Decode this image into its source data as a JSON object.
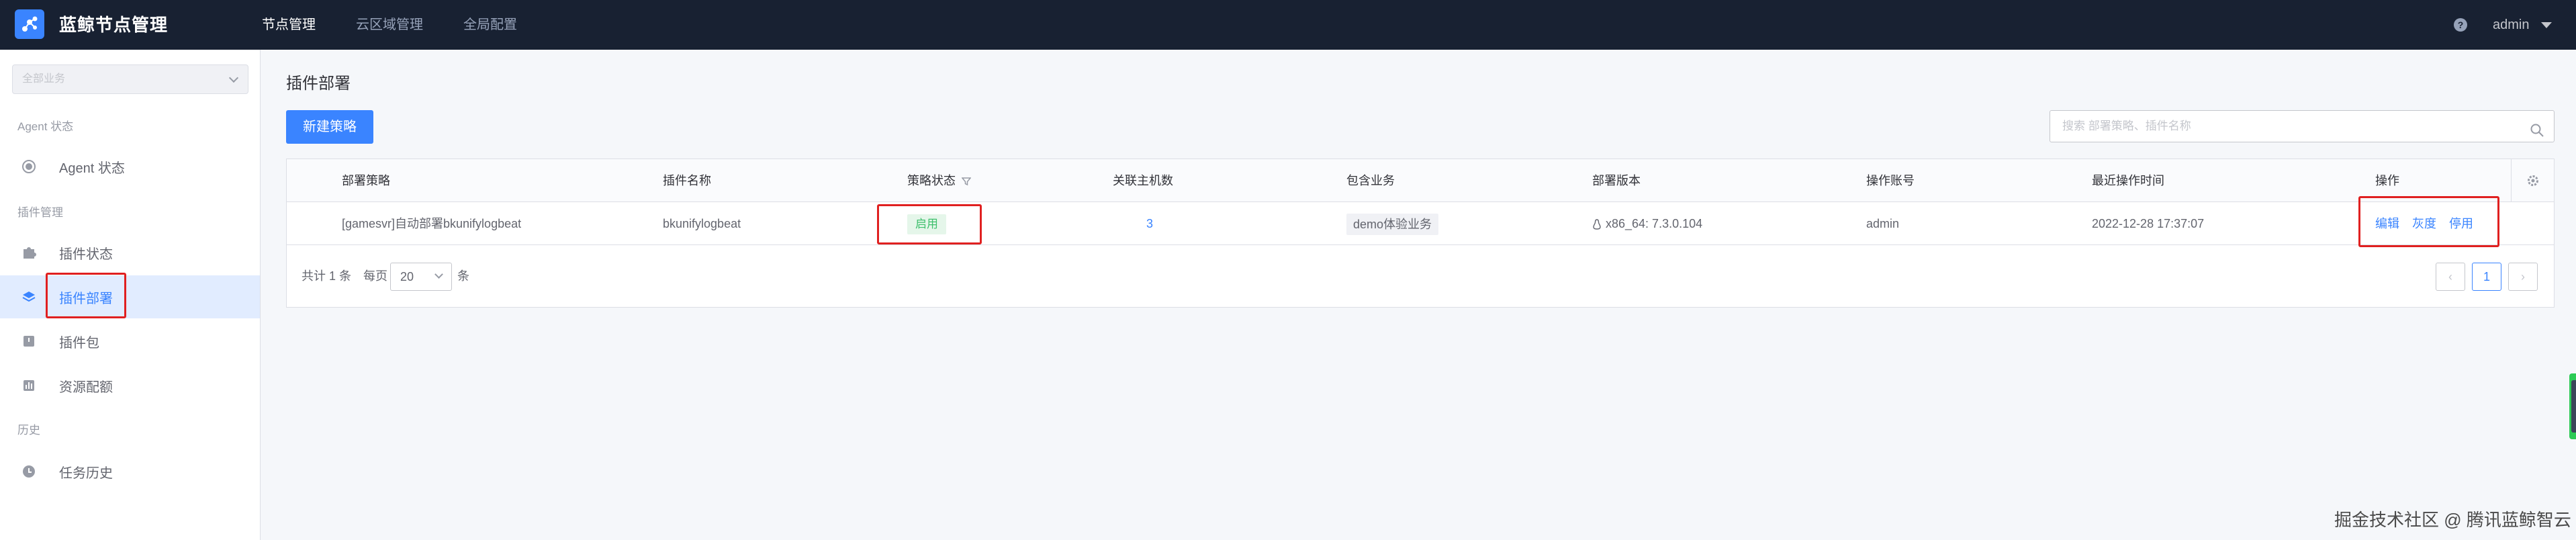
{
  "header": {
    "app_title": "蓝鲸节点管理",
    "nav": [
      "节点管理",
      "云区域管理",
      "全局配置"
    ],
    "user": "admin"
  },
  "sidebar": {
    "business_select": "全部业务",
    "groups": {
      "agent": "Agent 状态",
      "plugin": "插件管理",
      "history": "历史"
    },
    "items": [
      {
        "label": "Agent 状态",
        "icon": "agent-status-icon"
      },
      {
        "label": "插件状态",
        "icon": "puzzle-icon"
      },
      {
        "label": "插件部署",
        "icon": "layers-icon"
      },
      {
        "label": "插件包",
        "icon": "package-icon"
      },
      {
        "label": "资源配额",
        "icon": "quota-icon"
      },
      {
        "label": "任务历史",
        "icon": "clock-icon"
      }
    ]
  },
  "main": {
    "title": "插件部署",
    "new_button": "新建策略",
    "search_placeholder": "搜索 部署策略、插件名称",
    "columns": [
      "部署策略",
      "插件名称",
      "策略状态",
      "关联主机数",
      "包含业务",
      "部署版本",
      "操作账号",
      "最近操作时间",
      "操作"
    ],
    "rows": [
      {
        "policy": "[gamesvr]自动部署bkunifylogbeat",
        "plugin": "bkunifylogbeat",
        "status": "启用",
        "hosts": "3",
        "business": "demo体验业务",
        "version": "x86_64: 7.3.0.104",
        "operator": "admin",
        "time": "2022-12-28 17:37:07",
        "actions": [
          "编辑",
          "灰度",
          "停用"
        ]
      }
    ],
    "pagination": {
      "total_text": "共计 1 条",
      "per_page_prefix": "每页",
      "page_size": "20",
      "per_page_suffix": "条",
      "current_page": "1"
    }
  },
  "watermark": "掘金技术社区 @ 腾讯蓝鲸智云",
  "colors": {
    "topbar": "#182132",
    "accent": "#3a84ff",
    "highlight": "#e02020",
    "status_green": "#3fc06d"
  }
}
